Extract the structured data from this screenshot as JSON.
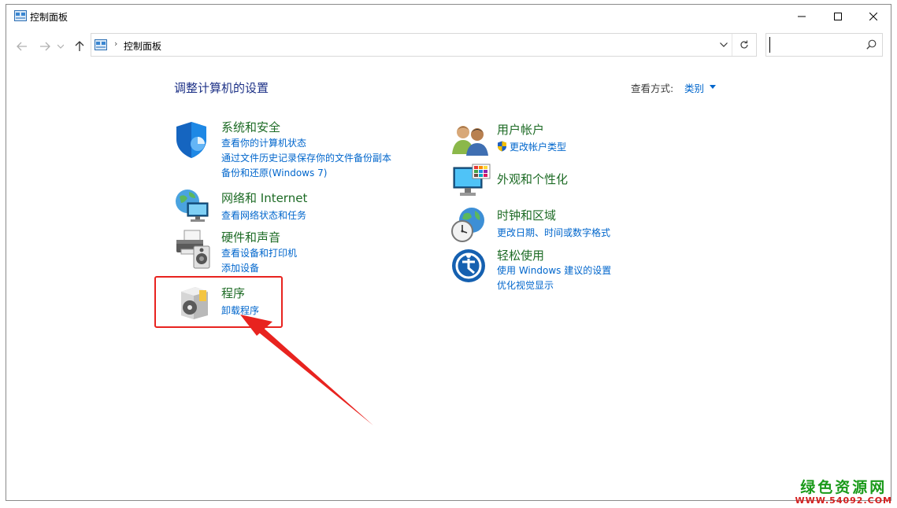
{
  "window": {
    "title": "控制面板",
    "icon": "control-panel-icon"
  },
  "address": {
    "separator": "›",
    "path": "控制面板"
  },
  "search": {
    "placeholder": "",
    "value": ""
  },
  "main": {
    "heading": "调整计算机的设置",
    "view_by_label": "查看方式:",
    "view_by_value": "类别"
  },
  "categories_left": [
    {
      "title": "系统和安全",
      "icon": "shield-icon",
      "links": [
        "查看你的计算机状态",
        "通过文件历史记录保存你的文件备份副本",
        "备份和还原(Windows 7)"
      ]
    },
    {
      "title": "网络和 Internet",
      "icon": "network-globe-icon",
      "links": [
        "查看网络状态和任务"
      ]
    },
    {
      "title": "硬件和声音",
      "icon": "printer-speaker-icon",
      "links": [
        "查看设备和打印机",
        "添加设备"
      ]
    },
    {
      "title": "程序",
      "icon": "programs-box-icon",
      "links": [
        "卸载程序"
      ]
    }
  ],
  "categories_right": [
    {
      "title": "用户帐户",
      "icon": "users-icon",
      "links": [
        "更改帐户类型"
      ]
    },
    {
      "title": "外观和个性化",
      "icon": "monitor-palette-icon",
      "links": []
    },
    {
      "title": "时钟和区域",
      "icon": "clock-globe-icon",
      "links": [
        "更改日期、时间或数字格式"
      ]
    },
    {
      "title": "轻松使用",
      "icon": "ease-of-access-icon",
      "links": [
        "使用 Windows 建议的设置",
        "优化视觉显示"
      ]
    }
  ],
  "watermark": {
    "main": "绿色资源网",
    "url": "WWW.54092.COM"
  },
  "colors": {
    "heading": "#1e3287",
    "category_title": "#1d6b25",
    "link": "#0066cc",
    "highlight": "#e8231f"
  }
}
